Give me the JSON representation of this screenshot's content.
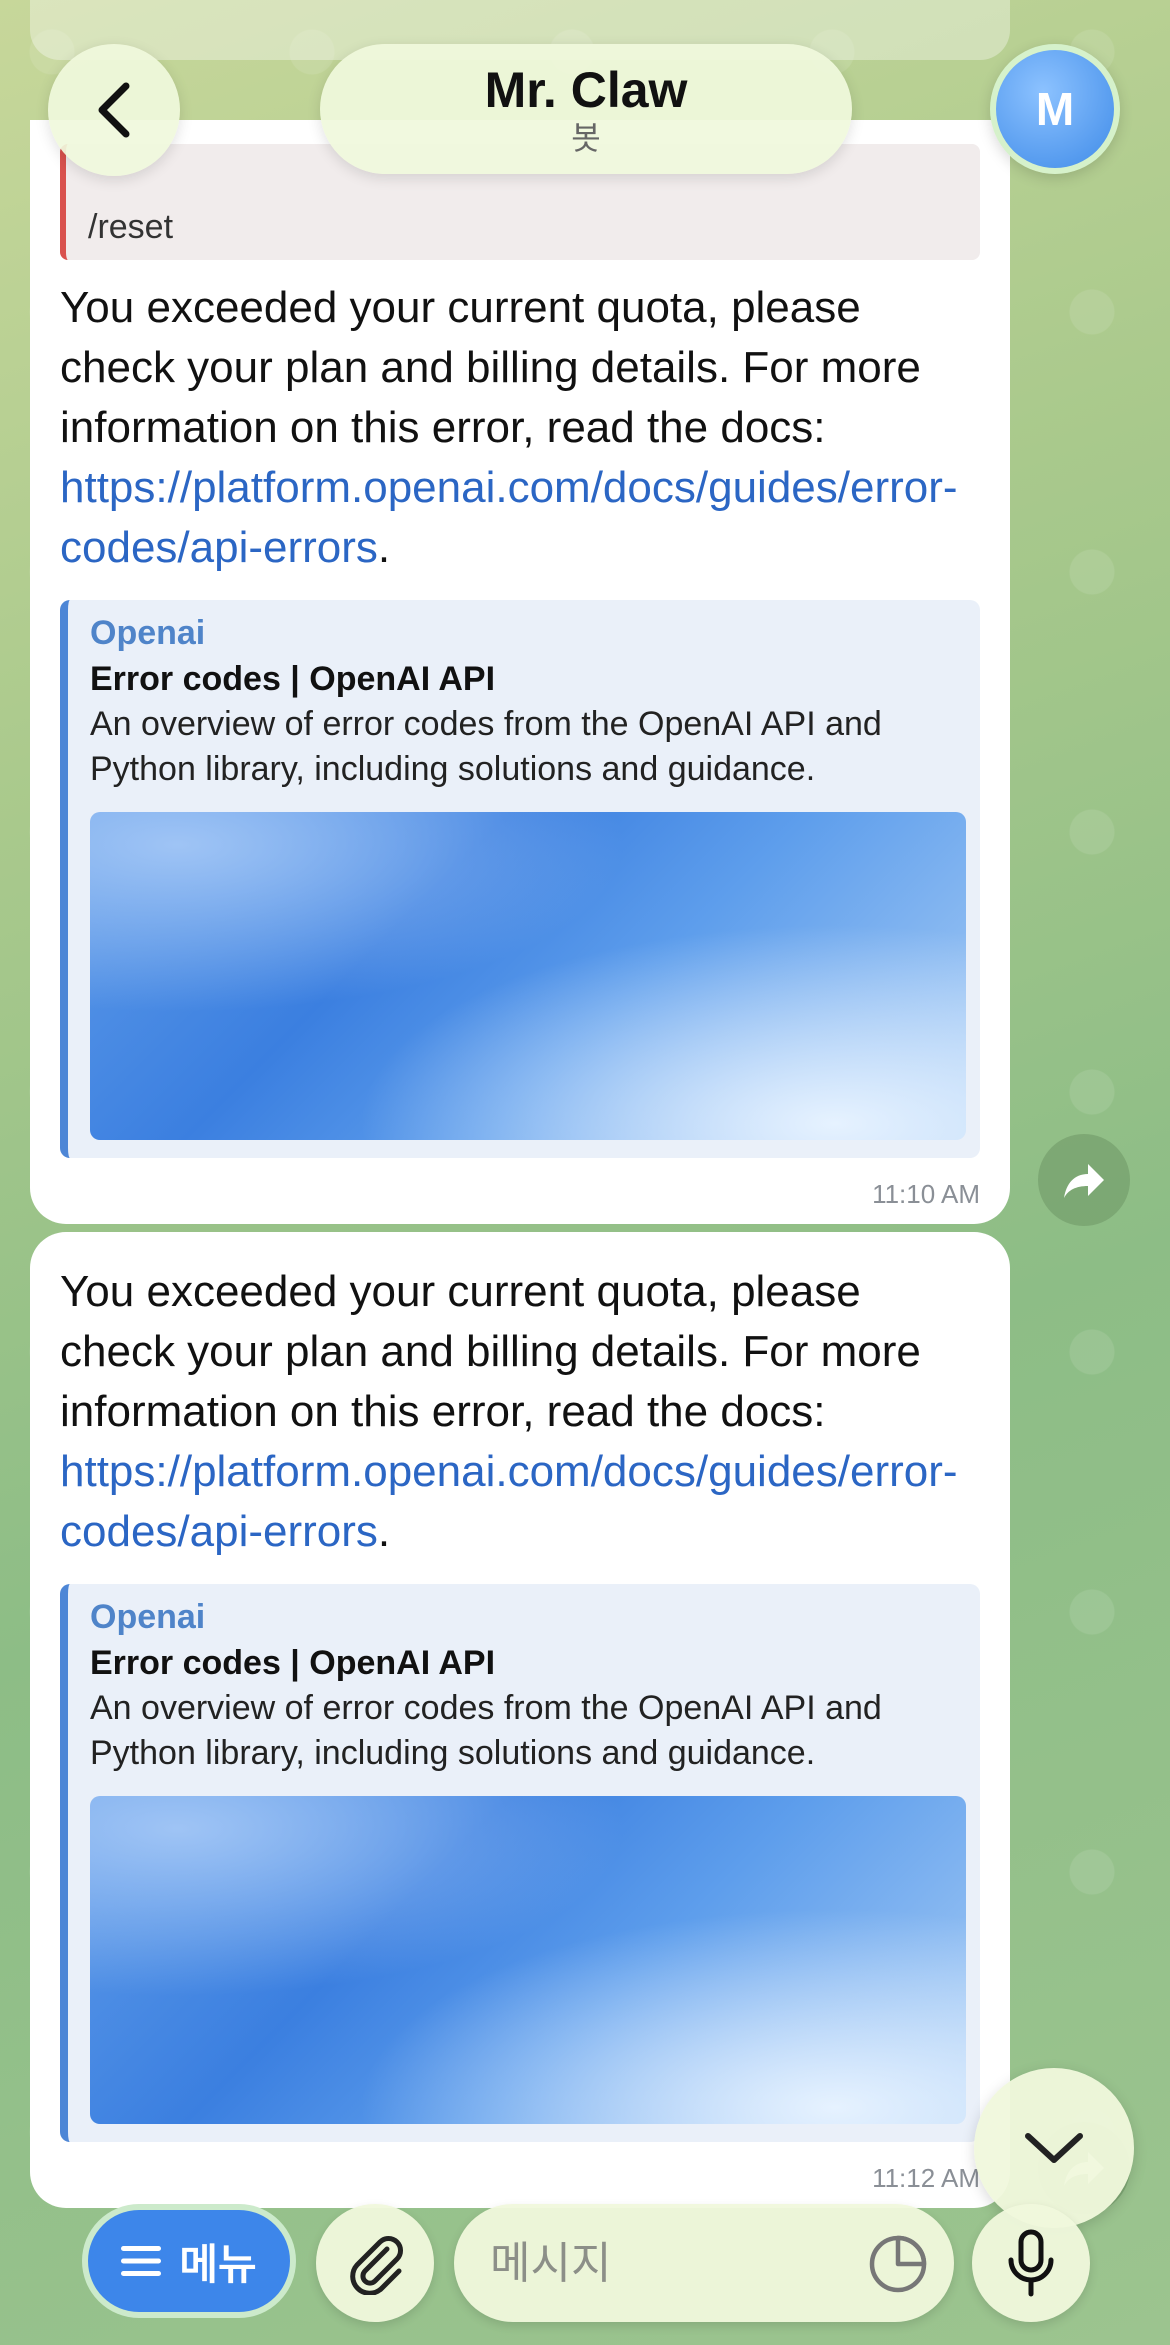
{
  "header": {
    "title": "Mr. Claw",
    "subtitle": "봇",
    "avatar_letter": "M"
  },
  "messages": [
    {
      "quote_text": "/reset",
      "text": "You exceeded your current quota, please check your plan and billing details. For more information on this error, read the docs: ",
      "link": "https://platform.openai.com/docs/guides/error-codes/api-errors",
      "trailing": ".",
      "preview": {
        "site": "Openai",
        "title": "Error codes | OpenAI API",
        "description": "An overview of error codes from the OpenAI API and Python library, including solutions and guidance."
      },
      "time": "11:10 AM"
    },
    {
      "text": "You exceeded your current quota, please check your plan and billing details. For more information on this error, read the docs: ",
      "link": "https://platform.openai.com/docs/guides/error-codes/api-errors",
      "trailing": ".",
      "preview": {
        "site": "Openai",
        "title": "Error codes | OpenAI API",
        "description": "An overview of error codes from the OpenAI API and Python library, including solutions and guidance."
      },
      "time": "11:12 AM"
    }
  ],
  "composer": {
    "menu_label": "메뉴",
    "placeholder": "메시지"
  },
  "colors": {
    "accent": "#3d86ea",
    "link": "#2b66c4",
    "quote_bar": "#d9524e"
  }
}
